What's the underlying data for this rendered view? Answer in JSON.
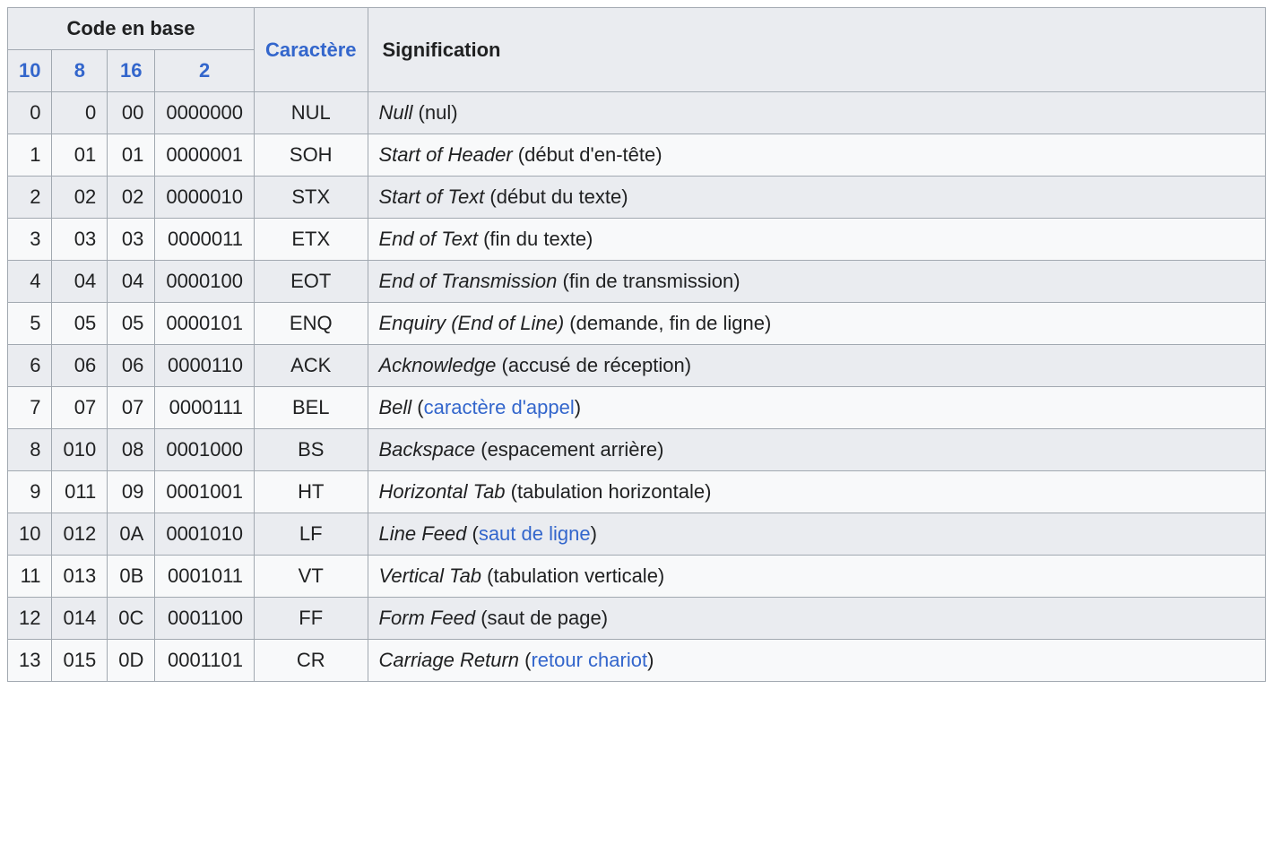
{
  "headers": {
    "code_group": "Code en base",
    "base10": "10",
    "base8": "8",
    "base16": "16",
    "base2": "2",
    "char": "Caractère",
    "sig": "Signification"
  },
  "rows": [
    {
      "dec": "0",
      "oct": "0",
      "hex": "00",
      "bin": "0000000",
      "char": "NUL",
      "sig_italic": "Null",
      "sig_plain_pre": " (nul)",
      "sig_link": "",
      "sig_plain_post": ""
    },
    {
      "dec": "1",
      "oct": "01",
      "hex": "01",
      "bin": "0000001",
      "char": "SOH",
      "sig_italic": "Start of Header",
      "sig_plain_pre": " (début d'en-tête)",
      "sig_link": "",
      "sig_plain_post": ""
    },
    {
      "dec": "2",
      "oct": "02",
      "hex": "02",
      "bin": "0000010",
      "char": "STX",
      "sig_italic": "Start of Text",
      "sig_plain_pre": " (début du texte)",
      "sig_link": "",
      "sig_plain_post": ""
    },
    {
      "dec": "3",
      "oct": "03",
      "hex": "03",
      "bin": "0000011",
      "char": "ETX",
      "sig_italic": "End of Text",
      "sig_plain_pre": " (fin du texte)",
      "sig_link": "",
      "sig_plain_post": ""
    },
    {
      "dec": "4",
      "oct": "04",
      "hex": "04",
      "bin": "0000100",
      "char": "EOT",
      "sig_italic": "End of Transmission",
      "sig_plain_pre": " (fin de transmission)",
      "sig_link": "",
      "sig_plain_post": ""
    },
    {
      "dec": "5",
      "oct": "05",
      "hex": "05",
      "bin": "0000101",
      "char": "ENQ",
      "sig_italic": "Enquiry (End of Line)",
      "sig_plain_pre": " (demande, fin de ligne)",
      "sig_link": "",
      "sig_plain_post": ""
    },
    {
      "dec": "6",
      "oct": "06",
      "hex": "06",
      "bin": "0000110",
      "char": "ACK",
      "sig_italic": "Acknowledge",
      "sig_plain_pre": " (accusé de réception)",
      "sig_link": "",
      "sig_plain_post": ""
    },
    {
      "dec": "7",
      "oct": "07",
      "hex": "07",
      "bin": "0000111",
      "char": "BEL",
      "sig_italic": "Bell",
      "sig_plain_pre": " (",
      "sig_link": "caractère d'appel",
      "sig_plain_post": ")"
    },
    {
      "dec": "8",
      "oct": "010",
      "hex": "08",
      "bin": "0001000",
      "char": "BS",
      "sig_italic": "Backspace",
      "sig_plain_pre": " (espacement arrière)",
      "sig_link": "",
      "sig_plain_post": ""
    },
    {
      "dec": "9",
      "oct": "011",
      "hex": "09",
      "bin": "0001001",
      "char": "HT",
      "sig_italic": "Horizontal Tab",
      "sig_plain_pre": " (tabulation horizontale)",
      "sig_link": "",
      "sig_plain_post": ""
    },
    {
      "dec": "10",
      "oct": "012",
      "hex": "0A",
      "bin": "0001010",
      "char": "LF",
      "sig_italic": "Line Feed",
      "sig_plain_pre": " (",
      "sig_link": "saut de ligne",
      "sig_plain_post": ")"
    },
    {
      "dec": "11",
      "oct": "013",
      "hex": "0B",
      "bin": "0001011",
      "char": "VT",
      "sig_italic": "Vertical Tab",
      "sig_plain_pre": " (tabulation verticale)",
      "sig_link": "",
      "sig_plain_post": ""
    },
    {
      "dec": "12",
      "oct": "014",
      "hex": "0C",
      "bin": "0001100",
      "char": "FF",
      "sig_italic": "Form Feed",
      "sig_plain_pre": " (saut de page)",
      "sig_link": "",
      "sig_plain_post": ""
    },
    {
      "dec": "13",
      "oct": "015",
      "hex": "0D",
      "bin": "0001101",
      "char": "CR",
      "sig_italic": "Carriage Return",
      "sig_plain_pre": " (",
      "sig_link": "retour chariot",
      "sig_plain_post": ")"
    }
  ]
}
